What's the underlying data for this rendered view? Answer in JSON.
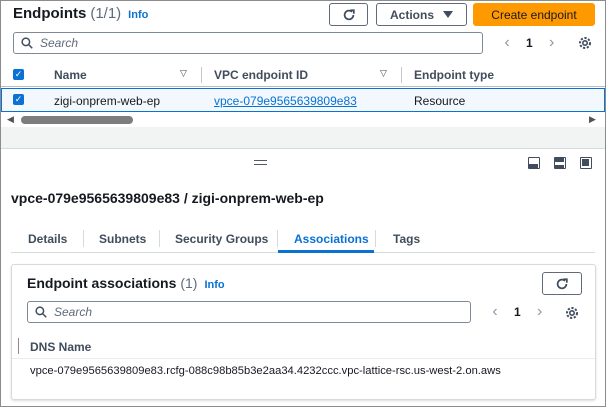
{
  "endpoints": {
    "title": "Endpoints",
    "count": "(1/1)",
    "info": "Info",
    "actions_label": "Actions",
    "create_label": "Create endpoint",
    "search_placeholder": "Search",
    "page": "1",
    "columns": [
      "Name",
      "VPC endpoint ID",
      "Endpoint type"
    ],
    "rows": [
      {
        "name": "zigi-onprem-web-ep",
        "id": "vpce-079e9565639809e83",
        "type": "Resource",
        "selected": true
      }
    ]
  },
  "detail": {
    "title": "vpce-079e9565639809e83 / zigi-onprem-web-ep",
    "tabs": [
      "Details",
      "Subnets",
      "Security Groups",
      "Associations",
      "Tags"
    ],
    "active_tab": "Associations",
    "associations": {
      "title": "Endpoint associations",
      "count": "(1)",
      "info": "Info",
      "search_placeholder": "Search",
      "page": "1",
      "column": "DNS Name",
      "rows": [
        "vpce-079e9565639809e83.rcfg-088c98b85b3e2aa34.4232ccc.vpc-lattice-rsc.us-west-2.on.aws"
      ]
    }
  },
  "colors": {
    "accent": "#0972d3",
    "primary": "#ff9900"
  },
  "icons": [
    "refresh-icon",
    "caret-down-icon",
    "search-icon",
    "chevron-left-icon",
    "chevron-right-icon",
    "gear-icon",
    "drag-handle-icon",
    "panel-bottom-icon",
    "panel-side-icon",
    "panel-full-icon"
  ]
}
